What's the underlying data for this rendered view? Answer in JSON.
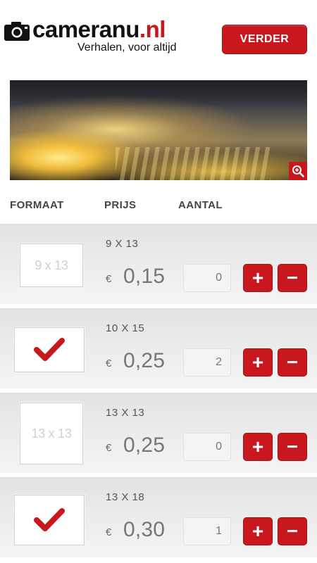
{
  "header": {
    "logo_main": "cameranu",
    "logo_suffix": ".nl",
    "tagline": "Verhalen, voor altijd",
    "continue_label": "VERDER"
  },
  "columns": {
    "format": "FORMAAT",
    "price": "PRIJS",
    "quantity": "AANTAL"
  },
  "currency": "€",
  "plus_label": "+",
  "minus_label": "−",
  "products": [
    {
      "size": "9 X 13",
      "thumb_text": "9 x 13",
      "selected": false,
      "price": "0,15",
      "quantity": "0"
    },
    {
      "size": "10 X 15",
      "thumb_text": "",
      "selected": true,
      "price": "0,25",
      "quantity": "2"
    },
    {
      "size": "13 X 13",
      "thumb_text": "13 x 13",
      "selected": false,
      "price": "0,25",
      "quantity": "0"
    },
    {
      "size": "13 X 18",
      "thumb_text": "",
      "selected": true,
      "price": "0,30",
      "quantity": "1"
    }
  ],
  "colors": {
    "accent": "#c8181e",
    "row_bg": "#ededed",
    "text_grey": "#777777"
  },
  "icons": {
    "camera": "camera-icon",
    "zoom": "zoom-in-icon",
    "check": "checkmark-icon"
  }
}
